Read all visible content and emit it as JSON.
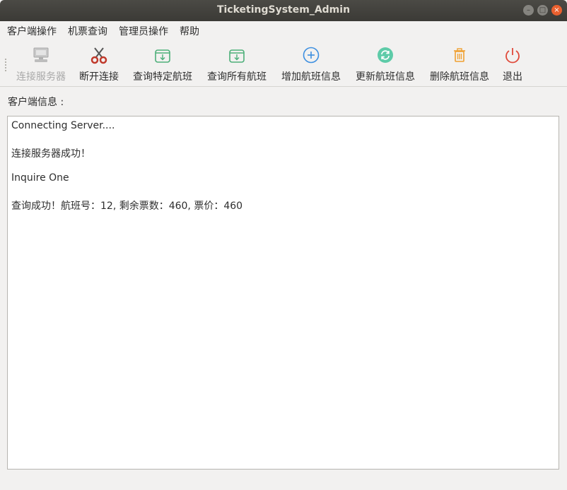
{
  "window": {
    "title": "TicketingSystem_Admin",
    "controls": {
      "minimize": "–",
      "maximize": "□",
      "close": "×"
    }
  },
  "menubar": {
    "items": [
      "客户端操作",
      "机票查询",
      "管理员操作",
      "帮助"
    ]
  },
  "toolbar": {
    "items": [
      {
        "label": "连接服务器",
        "icon": "server-icon",
        "enabled": false
      },
      {
        "label": "断开连接",
        "icon": "scissors-icon",
        "enabled": true
      },
      {
        "label": "查询特定航班",
        "icon": "download-box-icon",
        "enabled": true
      },
      {
        "label": "查询所有航班",
        "icon": "download-box-icon",
        "enabled": true
      },
      {
        "label": "增加航班信息",
        "icon": "plus-circle-icon",
        "enabled": true
      },
      {
        "label": "更新航班信息",
        "icon": "refresh-icon",
        "enabled": true
      },
      {
        "label": "删除航班信息",
        "icon": "trash-icon",
        "enabled": true
      },
      {
        "label": "退出",
        "icon": "power-icon",
        "enabled": true
      }
    ]
  },
  "client_info": {
    "label": "客户端信息 :",
    "lines": [
      "Connecting Server....",
      "连接服务器成功！",
      "Inquire One",
      "查询成功！航班号：12, 剩余票数：460, 票价：460"
    ]
  },
  "colors": {
    "titlebar": "#3c3b37",
    "close_button": "#e9602f",
    "green_icon": "#4caf79",
    "blue_icon": "#3d8fe0",
    "orange_icon": "#f0a030",
    "red_icon": "#e04a3a"
  }
}
